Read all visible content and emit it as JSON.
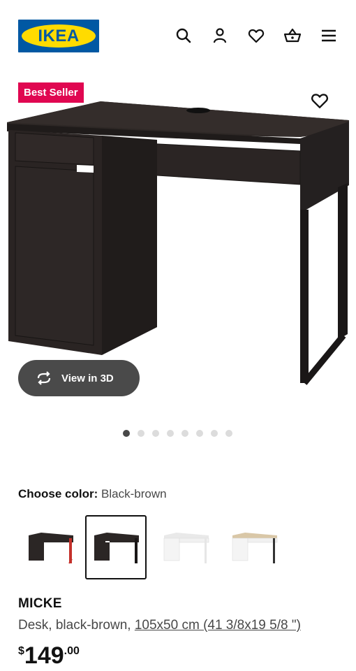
{
  "header": {
    "logo_text": "IKEA",
    "icons": [
      "search-icon",
      "user-icon",
      "heart-icon",
      "basket-icon",
      "menu-icon"
    ]
  },
  "product_media": {
    "badge": "Best Seller",
    "view_3d_label": "View in 3D",
    "carousel_total": 8,
    "carousel_active": 1
  },
  "color_chooser": {
    "label": "Choose color:",
    "selected_value": "Black-brown",
    "options": [
      "black-red",
      "black-brown",
      "white",
      "white-oak"
    ]
  },
  "product": {
    "name": "MICKE",
    "description_prefix": "Desk, black-brown, ",
    "dimensions": "105x50 cm (41 3/8x19 5/8 \")",
    "price_currency": "$",
    "price_integer": "149",
    "price_decimal": ".00"
  },
  "colors": {
    "badge": "#e00751",
    "logo_blue": "#0058a3",
    "logo_yellow": "#ffdb00",
    "desk": "#2b2624"
  }
}
